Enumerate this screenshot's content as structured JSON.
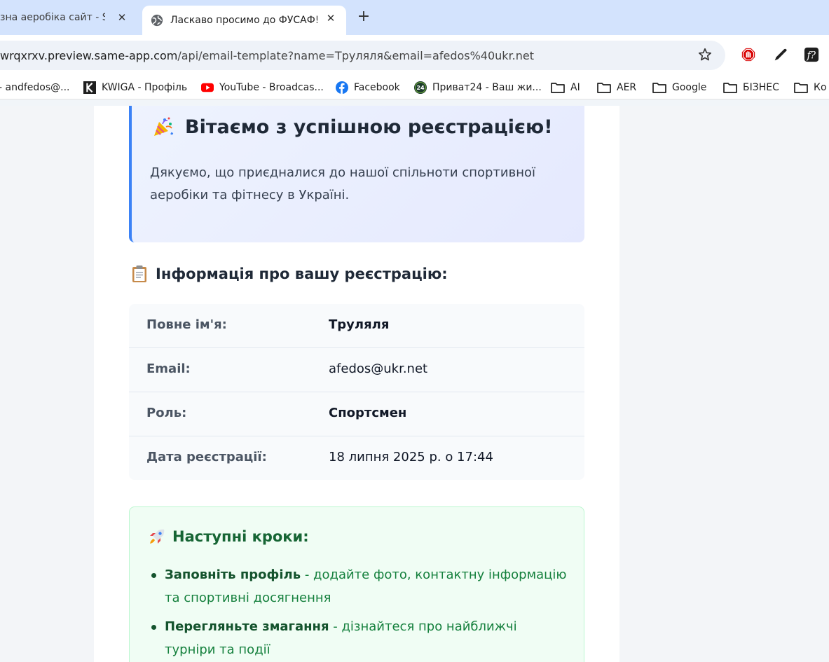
{
  "browser": {
    "tabs": [
      {
        "title": "зна аеробіка сайт - Same",
        "active": false
      },
      {
        "title": "Ласкаво просимо до ФУСАФ!",
        "active": true
      }
    ],
    "url_host": "wrqxrxv.preview.same-app.com",
    "url_path": "/api/email-template?name=Труляля&email=afedos%40ukr.net",
    "bookmarks": [
      {
        "label": "- andfedos@...",
        "icon": "mail-icon"
      },
      {
        "label": "KWIGA - Профіль",
        "icon": "kwiga-icon"
      },
      {
        "label": "YouTube - Broadcas...",
        "icon": "youtube-icon"
      },
      {
        "label": "Facebook",
        "icon": "facebook-icon"
      },
      {
        "label": "Приват24 - Ваш жи...",
        "icon": "privat24-icon"
      },
      {
        "label": "AI",
        "icon": "folder-icon"
      },
      {
        "label": "AER",
        "icon": "folder-icon"
      },
      {
        "label": "Google",
        "icon": "folder-icon"
      },
      {
        "label": "БІЗНЕС",
        "icon": "folder-icon"
      },
      {
        "label": "Ко",
        "icon": "folder-icon"
      }
    ]
  },
  "email": {
    "welcome_title": "Вітаємо з успішною реєстрацією!",
    "welcome_text": "Дякуємо, що приєдналися до нашої спільноти спортивної аеробіки та фітнесу в Україні.",
    "info_title": "Інформація про вашу реєстрацію:",
    "info_rows": [
      {
        "label": "Повне ім'я:",
        "value": "Труляля"
      },
      {
        "label": "Email:",
        "value": "afedos@ukr.net"
      },
      {
        "label": "Роль:",
        "value": "Спортсмен"
      },
      {
        "label": "Дата реєстрації:",
        "value": "18 липня 2025 р. о 17:44"
      }
    ],
    "steps_title": "Наступні кроки:",
    "steps": [
      {
        "bold": "Заповніть профіль",
        "text": " - додайте фото, контактну інформацію та спортивні досягнення"
      },
      {
        "bold": "Перегляньте змагання",
        "text": " - дізнайтеся про найближчі турніри та події"
      }
    ]
  },
  "colors": {
    "accent_blue": "#3b82f6",
    "steps_green": "#15803d",
    "tabstrip": "#d3e3fd"
  }
}
